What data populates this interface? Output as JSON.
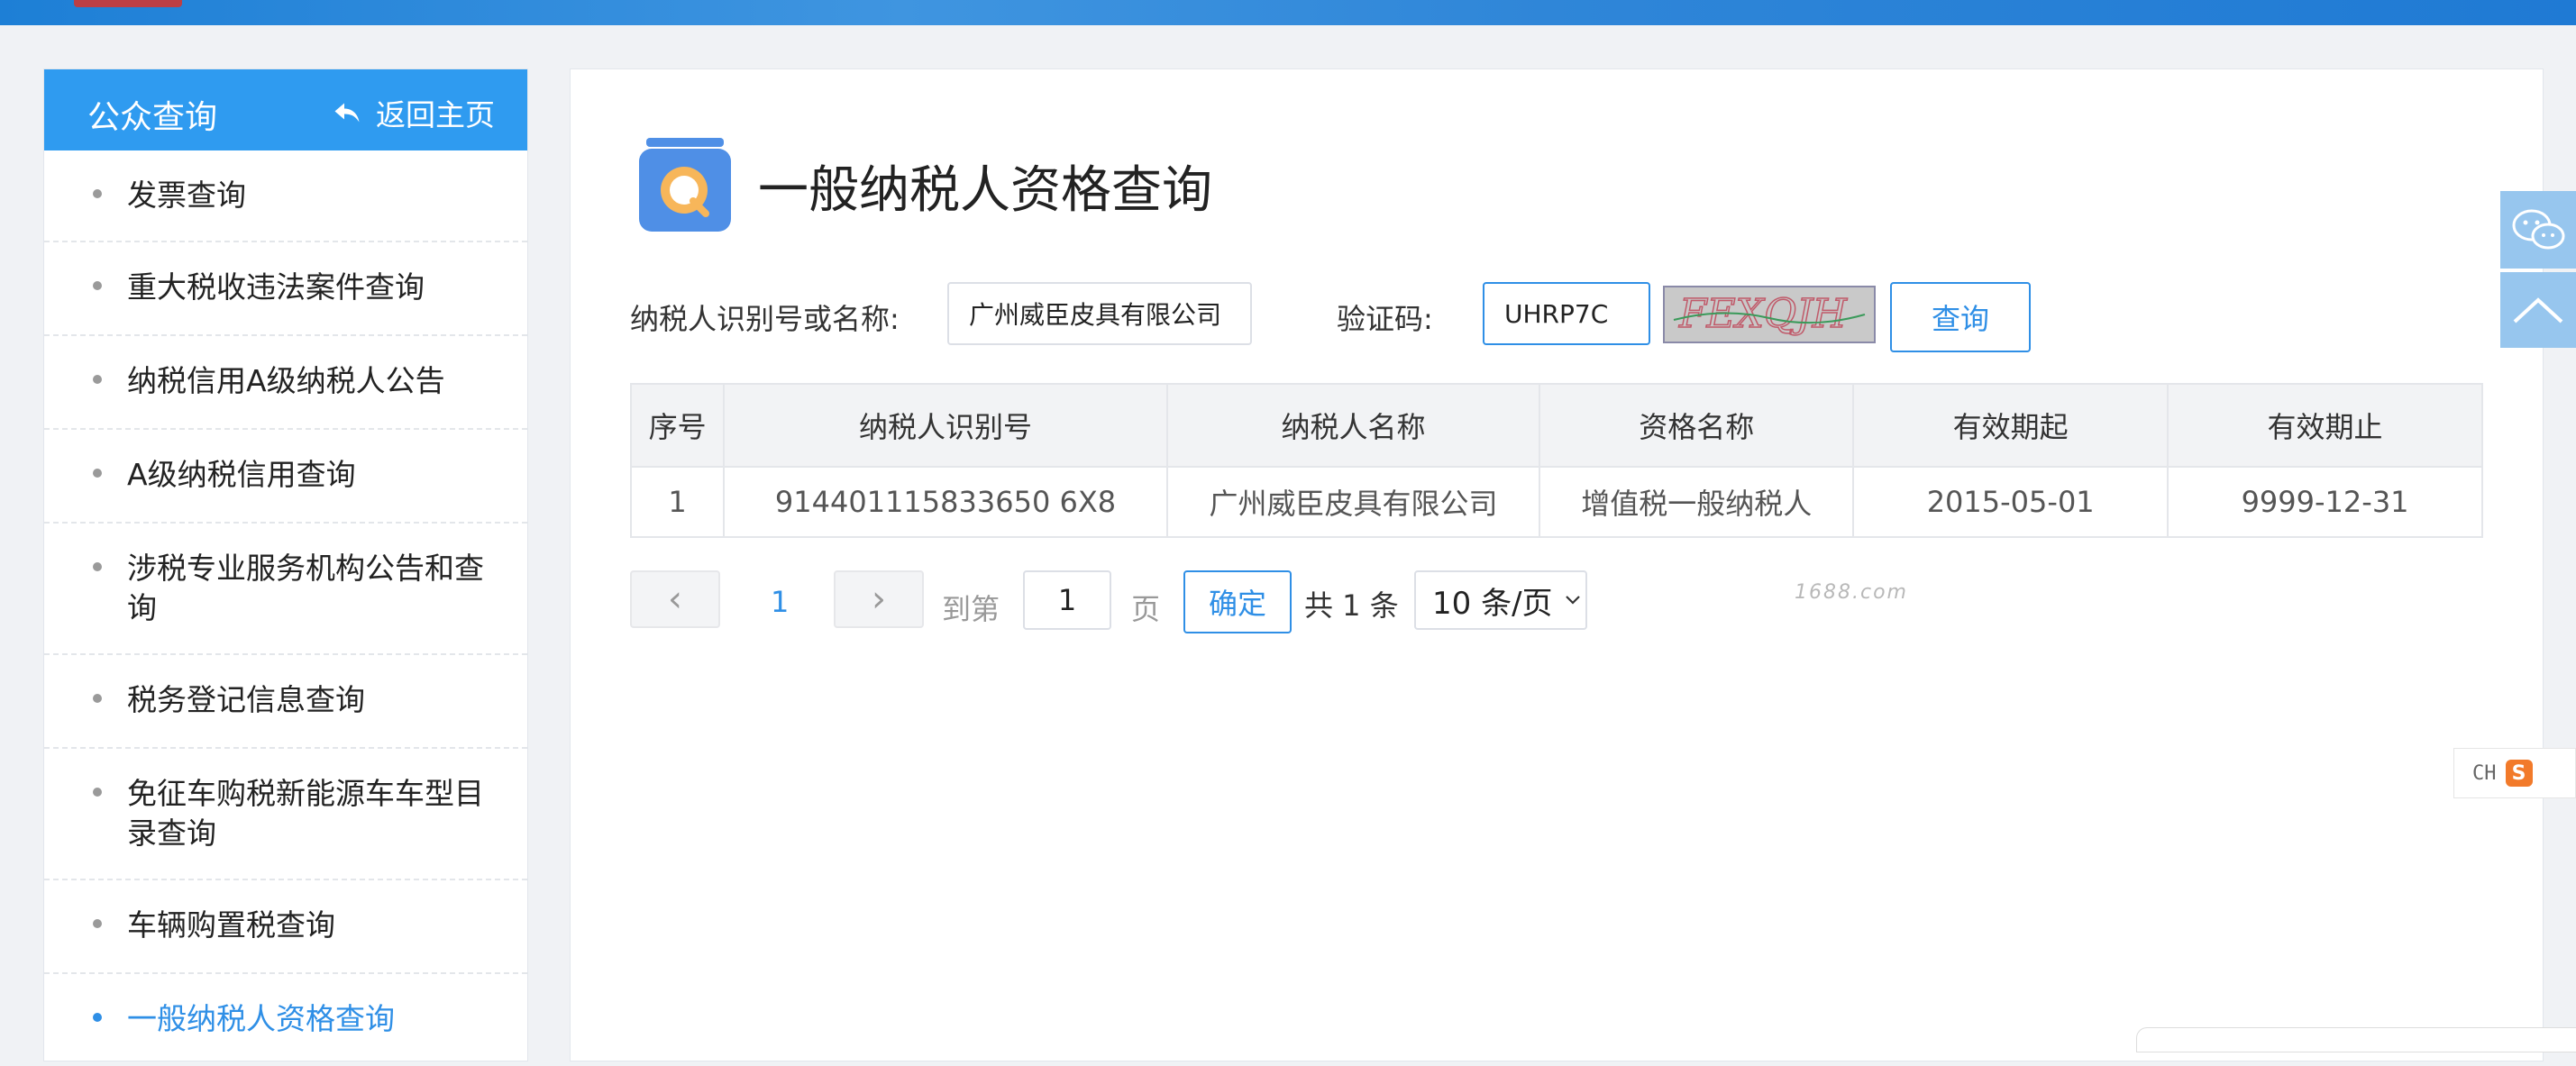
{
  "sidebar": {
    "title": "公众查询",
    "back_home": "返回主页",
    "items": [
      {
        "label": "发票查询"
      },
      {
        "label": "重大税收违法案件查询"
      },
      {
        "label": "纳税信用A级纳税人公告"
      },
      {
        "label": "A级纳税信用查询"
      },
      {
        "label": "涉税专业服务机构公告和查询"
      },
      {
        "label": "税务登记信息查询"
      },
      {
        "label": "免征车购税新能源车车型目录查询"
      },
      {
        "label": "车辆购置税查询"
      },
      {
        "label": "一般纳税人资格查询",
        "active": true
      }
    ]
  },
  "main": {
    "page_title": "一般纳税人资格查询",
    "form": {
      "taxpayer_label": "纳税人识别号或名称:",
      "taxpayer_value": "广州威臣皮具有限公司",
      "captcha_label": "验证码:",
      "captcha_value": "UHRP7C",
      "captcha_image_text": "FEXQJH",
      "query_button": "查询"
    },
    "table": {
      "headers": [
        "序号",
        "纳税人识别号",
        "纳税人名称",
        "资格名称",
        "有效期起",
        "有效期止"
      ],
      "rows": [
        [
          "1",
          "914401115833650 6X8",
          "广州威臣皮具有限公司",
          "增值税一般纳税人",
          "2015-05-01",
          "9999-12-31"
        ]
      ]
    },
    "pagination": {
      "prev": "‹",
      "current_page": "1",
      "next": "›",
      "goto_label": "到第",
      "goto_value": "1",
      "page_unit": "页",
      "confirm": "确定",
      "total": "共 1 条",
      "page_size": "10 条/页"
    },
    "watermark": "1688.com"
  },
  "ime": {
    "text": "CH",
    "logo": "S"
  },
  "colors": {
    "accent": "#2f8fe6",
    "header_blue": "#2f9bf0",
    "top_bar": "#1d7fd6"
  }
}
